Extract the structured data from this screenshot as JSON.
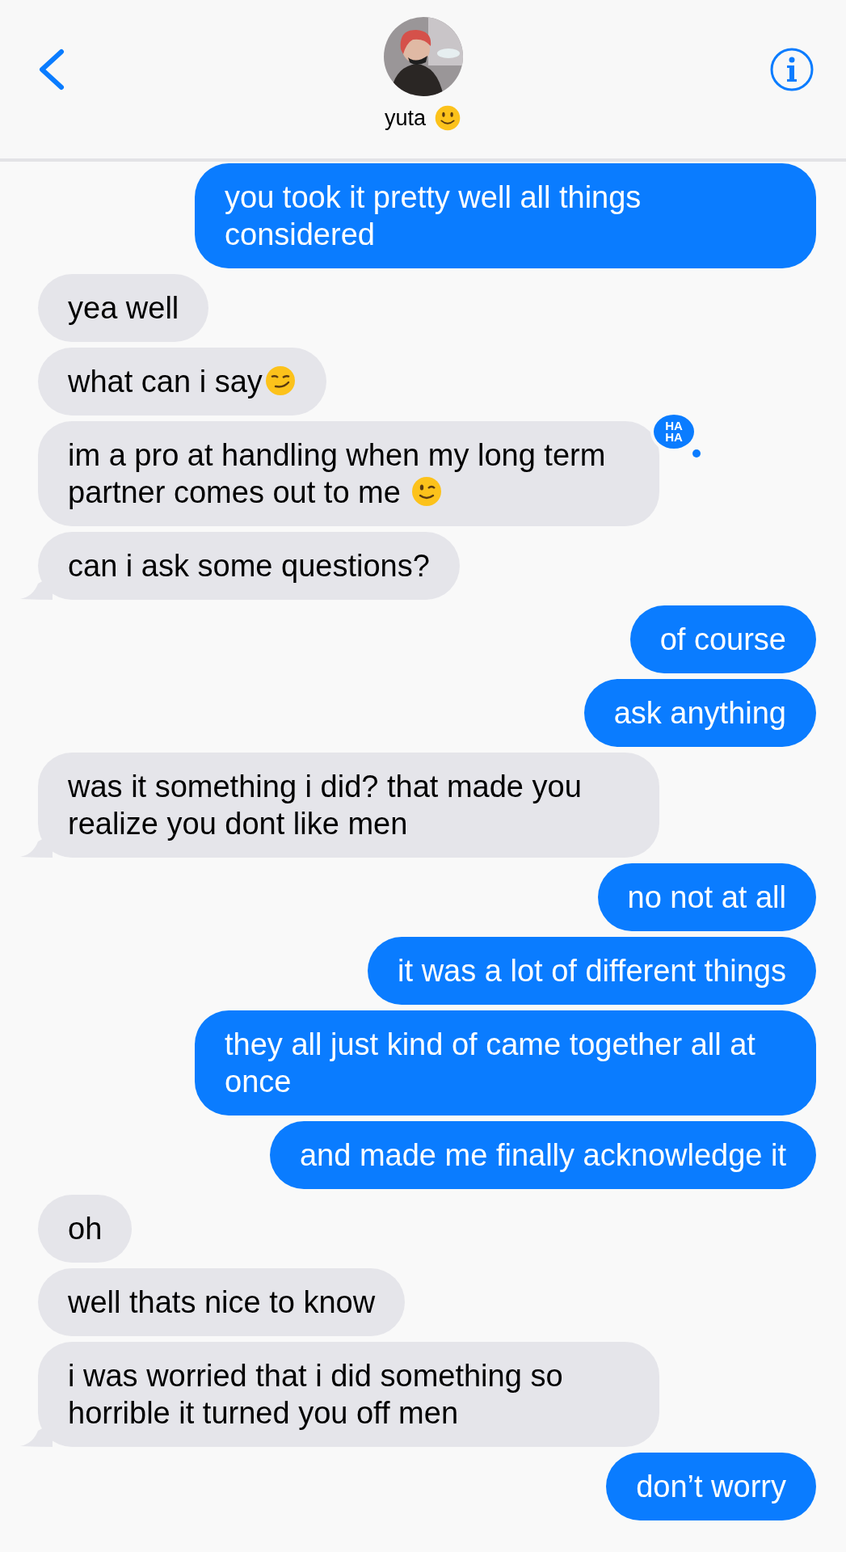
{
  "header": {
    "contact_name": "yuta",
    "contact_emoji": {
      "kind": "smile"
    }
  },
  "messages": [
    {
      "kind": "sent",
      "text": "you took it pretty well all things considered"
    },
    {
      "kind": "received",
      "text": "yea well"
    },
    {
      "kind": "received",
      "text": "what can i say",
      "emoji": {
        "kind": "smirk"
      }
    },
    {
      "kind": "received",
      "text": "im a pro at handling when my long term partner comes out to me ",
      "emoji": {
        "kind": "wink"
      },
      "reaction": "HA HA"
    },
    {
      "kind": "received",
      "text": "can i ask some questions?",
      "tail": true
    },
    {
      "kind": "sent",
      "text": "of course"
    },
    {
      "kind": "sent",
      "text": "ask anything"
    },
    {
      "kind": "received",
      "text": "was it something i did? that made you realize you dont like men",
      "tail": true
    },
    {
      "kind": "sent",
      "text": "no not at all"
    },
    {
      "kind": "sent",
      "text": "it was a lot of different things"
    },
    {
      "kind": "sent",
      "text": "they all just kind of came together all at once"
    },
    {
      "kind": "sent",
      "text": "and made me finally acknowledge it"
    },
    {
      "kind": "received",
      "text": "oh"
    },
    {
      "kind": "received",
      "text": "well thats nice to know"
    },
    {
      "kind": "received",
      "text": "i was worried that i did something so horrible it turned you off men",
      "tail": true
    },
    {
      "kind": "sent",
      "text": "don’t worry"
    }
  ]
}
